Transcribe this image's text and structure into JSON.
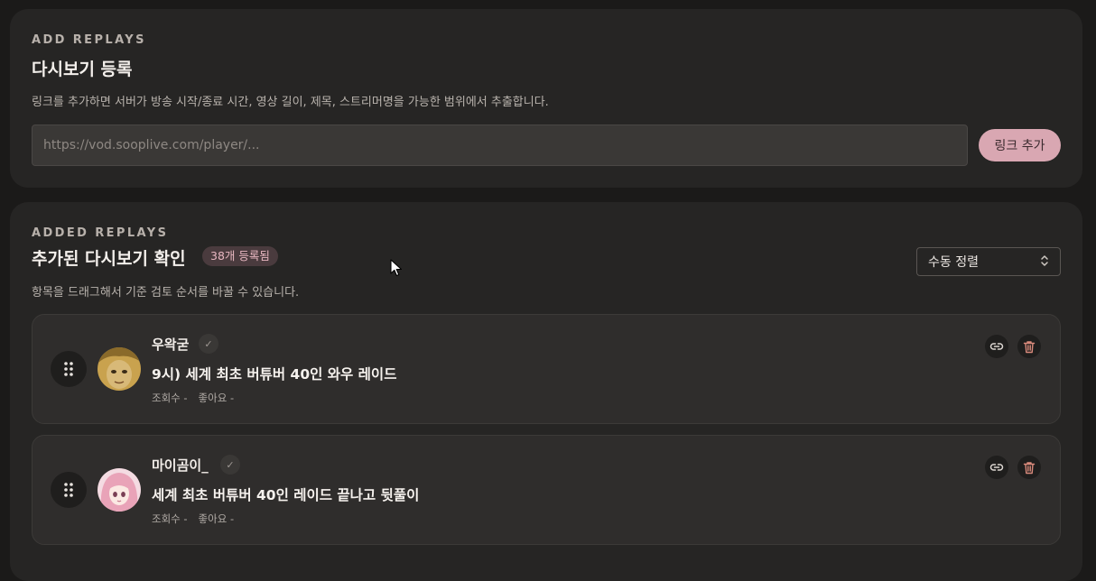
{
  "add_section": {
    "eyebrow": "ADD REPLAYS",
    "title": "다시보기 등록",
    "description": "링크를 추가하면 서버가 방송 시작/종료 시간, 영상 길이, 제목, 스트리머명을 가능한 범위에서 추출합니다.",
    "input_placeholder": "https://vod.sooplive.com/player/...",
    "input_value": "",
    "add_button_label": "링크 추가"
  },
  "list_section": {
    "eyebrow": "ADDED REPLAYS",
    "title": "추가된 다시보기 확인",
    "count_badge": "38개 등록됨",
    "description": "항목을 드래그해서 기준 검토 순서를 바꿀 수 있습니다.",
    "sort_select_value": "수동 정렬",
    "items": [
      {
        "author": "우왁굳",
        "title": "9시) 세계 최초 버튜버 40인 와우 레이드",
        "views_label": "조회수 -",
        "likes_label": "좋아요 -"
      },
      {
        "author": "마이곰이_",
        "title": "세계 최초 버튜버 40인 레이드 끝나고 뒷풀이",
        "views_label": "조회수 -",
        "likes_label": "좋아요 -"
      }
    ]
  },
  "icons": {
    "verified": "check-icon",
    "drag": "drag-handle-icon",
    "link": "link-icon",
    "delete": "trash-icon",
    "sort": "chevron-up-down-icon"
  },
  "colors": {
    "background": "#1b1a19",
    "panel": "#262524",
    "card": "#2f2d2c",
    "accent": "#d9a7b2",
    "badge_bg": "#4a3b3e",
    "badge_text": "#e8b7c1",
    "delete_icon": "#d98a7c"
  }
}
